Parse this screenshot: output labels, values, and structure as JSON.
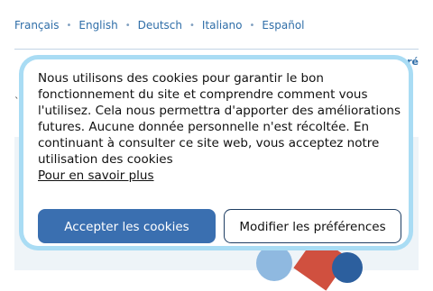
{
  "languages": [
    {
      "label": "Français"
    },
    {
      "label": "English"
    },
    {
      "label": "Deutsch"
    },
    {
      "label": "Italiano"
    },
    {
      "label": "Español"
    }
  ],
  "header": {
    "contrast_label": "Contraste amélioré",
    "partial_text": "`"
  },
  "cookie_banner": {
    "message": "Nous utilisons des cookies pour garantir le bon fonctionnement du site et comprendre comment vous l'utilisez. Cela nous permettra d'apporter des améliorations futures. Aucune donnée personnelle n'est récoltée. En continuant à consulter ce site web, vous acceptez notre utilisation des cookies",
    "learn_more_label": "Pour en savoir plus",
    "accept_label": "Accepter les cookies",
    "modify_label": "Modifier les préférences"
  },
  "colors": {
    "accent": "#3a6fb0",
    "link": "#2f6ea8",
    "modal_outline": "#a9dcf4"
  }
}
